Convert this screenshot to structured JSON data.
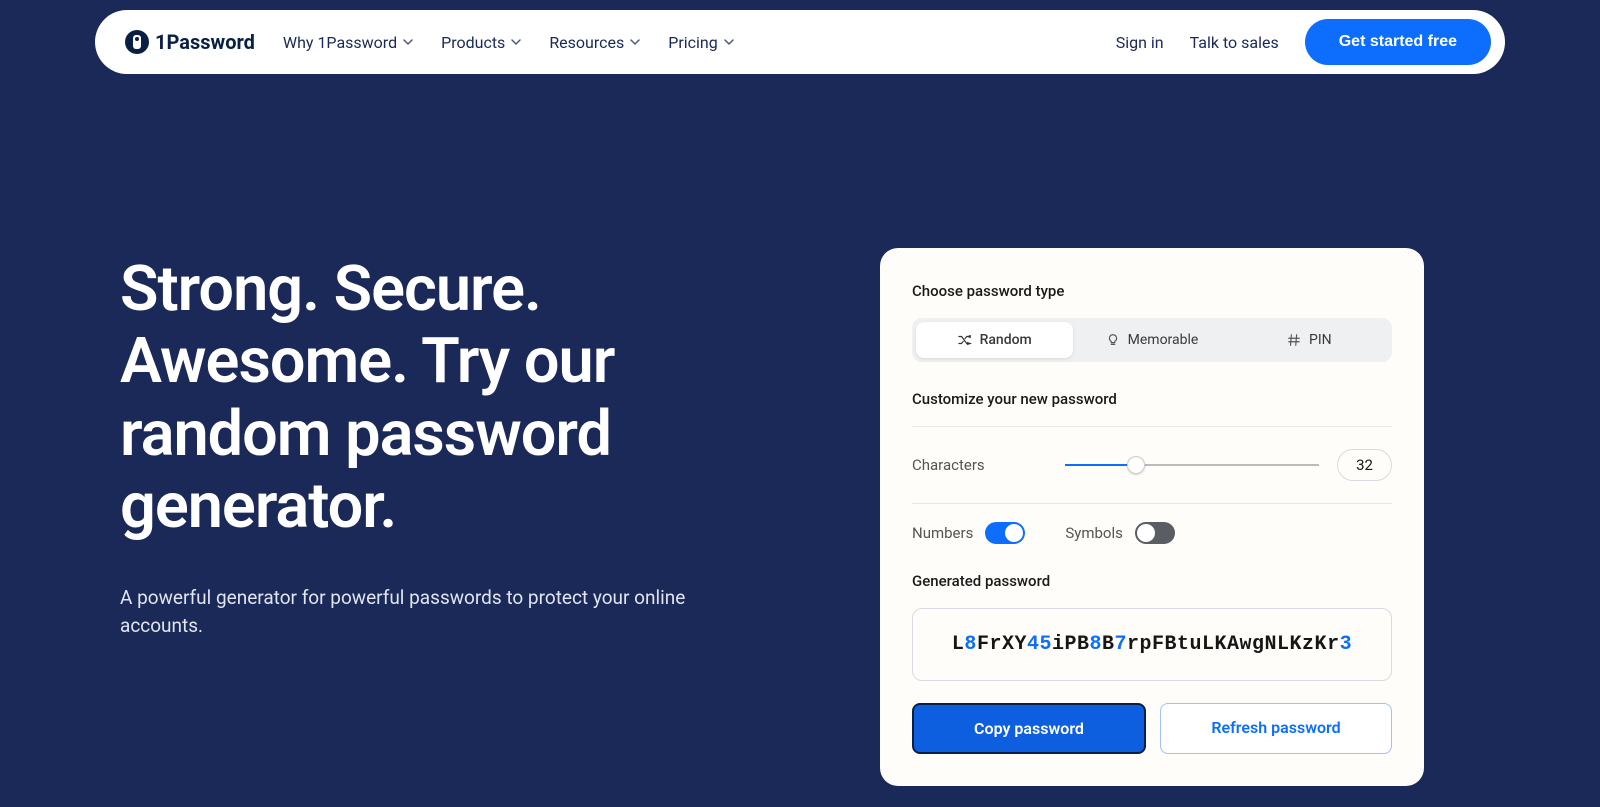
{
  "nav": {
    "brand": "1Password",
    "items": [
      "Why 1Password",
      "Products",
      "Resources",
      "Pricing"
    ],
    "signin": "Sign in",
    "talk": "Talk to sales",
    "cta": "Get started free"
  },
  "hero": {
    "title": "Strong. Secure. Awesome. Try our random password generator.",
    "subtitle": "A powerful generator for powerful passwords to protect your online accounts."
  },
  "card": {
    "type_label": "Choose password type",
    "tabs": {
      "random": "Random",
      "memorable": "Memorable",
      "pin": "PIN"
    },
    "customize_label": "Customize your new password",
    "characters_label": "Characters",
    "characters_value": "32",
    "numbers_label": "Numbers",
    "numbers_on": true,
    "symbols_label": "Symbols",
    "symbols_on": false,
    "generated_label": "Generated password",
    "password_segments": [
      {
        "t": "L",
        "d": false
      },
      {
        "t": "8",
        "d": true
      },
      {
        "t": "FrXY",
        "d": false
      },
      {
        "t": "45",
        "d": true
      },
      {
        "t": "iPB",
        "d": false
      },
      {
        "t": "8",
        "d": true
      },
      {
        "t": "B",
        "d": false
      },
      {
        "t": "7",
        "d": true
      },
      {
        "t": "rpFBtuLKAwgNLKzKr",
        "d": false
      },
      {
        "t": "3",
        "d": true
      }
    ],
    "copy_label": "Copy password",
    "refresh_label": "Refresh password"
  }
}
